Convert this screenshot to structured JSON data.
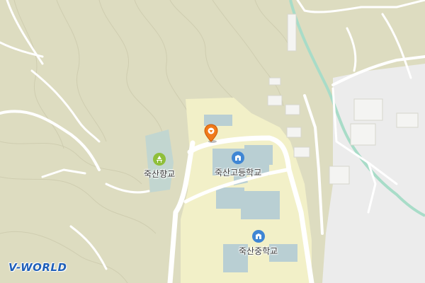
{
  "map": {
    "colors": {
      "land": "#dddcc0",
      "urban": "#ececec",
      "campus": "#f2f0c8",
      "building": "#b9cfd3",
      "road": "#ffffff",
      "road_edge": "#c8c8b8",
      "water": "#a8dcc8",
      "contour": "#cfcdb0"
    },
    "pois": [
      {
        "id": "hyanggyo",
        "label": "죽산향교",
        "icon": "shrine-icon",
        "color": "#8fbf3a"
      },
      {
        "id": "highschool",
        "label": "죽산고등학교",
        "icon": "school-icon",
        "color": "#3f86d4"
      },
      {
        "id": "middleschool",
        "label": "죽산중학교",
        "icon": "school-icon",
        "color": "#3f86d4"
      }
    ],
    "marker": {
      "icon": "location-pin-icon",
      "color": "#f07a1a"
    },
    "logo": "V-WORLD"
  }
}
